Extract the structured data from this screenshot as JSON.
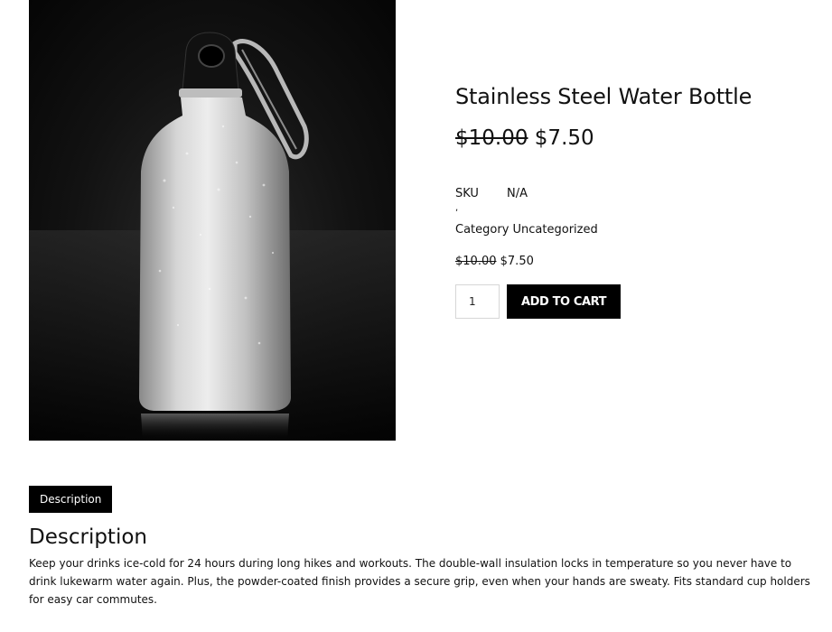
{
  "product": {
    "image_alt": "Stainless Steel Water Bottle",
    "title": "Stainless Steel Water Bottle",
    "price_regular": "$10.00",
    "price_sale": "$7.50",
    "meta": {
      "sku_label": "SKU",
      "sku_value": "N/A",
      "separator": ",",
      "category_label": "Category",
      "category_value": "Uncategorized"
    },
    "price_small_regular": "$10.00",
    "price_small_sale": "$7.50",
    "quantity": "1",
    "add_to_cart_label": "ADD TO CART"
  },
  "tabs": {
    "description_label": "Description"
  },
  "description": {
    "heading": "Description",
    "text": "Keep your drinks ice-cold for 24 hours during long hikes and workouts. The double-wall insulation locks in temperature so you never have to drink lukewarm water again. Plus, the powder-coated finish provides a secure grip, even when your hands are sweaty. Fits standard cup holders for easy car commutes."
  },
  "colors": {
    "button_bg": "#000000",
    "text": "#111111",
    "image_bg": "#0a0a0a"
  }
}
